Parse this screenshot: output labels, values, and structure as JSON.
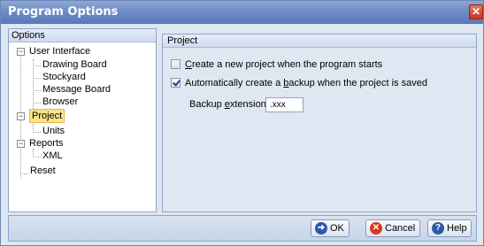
{
  "window": {
    "title": "Program Options",
    "close_glyph": "✕"
  },
  "left_panel": {
    "header": "Options",
    "tree": [
      {
        "label": "User Interface",
        "level": 0,
        "expander": "−"
      },
      {
        "label": "Drawing Board",
        "level": 1
      },
      {
        "label": "Stockyard",
        "level": 1
      },
      {
        "label": "Message Board",
        "level": 1
      },
      {
        "label": "Browser",
        "level": 1
      },
      {
        "label": "Project",
        "level": 0,
        "expander": "−",
        "selected": true
      },
      {
        "label": "Units",
        "level": 1
      },
      {
        "label": "Reports",
        "level": 0,
        "expander": "−"
      },
      {
        "label": "XML",
        "level": 1
      },
      {
        "label": "Reset",
        "level": 0
      }
    ]
  },
  "right_panel": {
    "header": "Project",
    "option_new_project": {
      "pre": "",
      "mnemonic": "C",
      "post": "reate a new project when the program starts",
      "checked": false
    },
    "option_backup": {
      "pre": "Automatically create a ",
      "mnemonic": "b",
      "post": "ackup when the project is saved",
      "checked": true
    },
    "backup_extension": {
      "label_pre": "Backup ",
      "mnemonic": "e",
      "label_post": "xtension",
      "value": ".xxx"
    }
  },
  "footer": {
    "ok": {
      "label": "OK",
      "icon": "ok-icon",
      "color": "#2a5aa8"
    },
    "cancel": {
      "label": "Cancel",
      "icon": "cancel-icon",
      "color": "#d9361f"
    },
    "help": {
      "label": "Help",
      "icon": "help-icon",
      "color": "#2a5aa8"
    }
  }
}
